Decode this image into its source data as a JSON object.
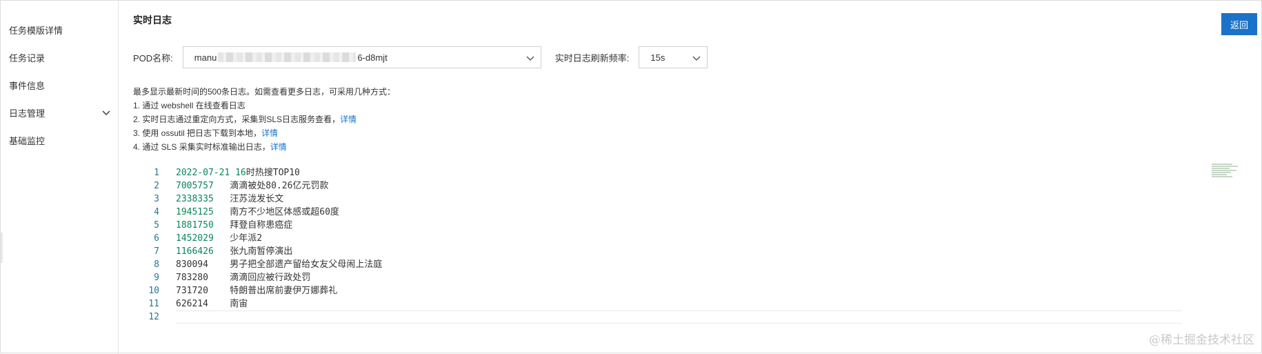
{
  "sidebar": {
    "items": [
      {
        "label": "任务模版详情"
      },
      {
        "label": "任务记录"
      },
      {
        "label": "事件信息"
      },
      {
        "label": "日志管理",
        "expandable": true
      },
      {
        "label": "基础监控"
      }
    ]
  },
  "header": {
    "title": "实时日志",
    "back_label": "返回"
  },
  "pod": {
    "label": "POD名称:",
    "value_prefix": "manu",
    "value_suffix": "6-d8mjt"
  },
  "refresh": {
    "label": "实时日志刷新频率:",
    "value": "15s"
  },
  "notice": {
    "line0": "最多显示最新时间的500条日志。如需查看更多日志，可采用几种方式：",
    "line1": "1. 通过 webshell 在线查看日志",
    "line2": "2. 实时日志通过重定向方式，采集到SLS日志服务查看，",
    "line2_link": "详情",
    "line3": "3. 使用 ossutil 把日志下载到本地，",
    "line3_link": "详情",
    "line4": "4. 通过 SLS 采集实时标准输出日志，",
    "line4_link": "详情"
  },
  "log": {
    "lines": [
      {
        "no": "1",
        "num": "2022-07-21 16",
        "text": "时热搜TOP10",
        "green": true
      },
      {
        "no": "2",
        "num": "7005757",
        "text": "   滴滴被处80.26亿元罚款",
        "green": true
      },
      {
        "no": "3",
        "num": "2338335",
        "text": "   汪苏泷发长文",
        "green": true
      },
      {
        "no": "4",
        "num": "1945125",
        "text": "   南方不少地区体感或超60度",
        "green": true
      },
      {
        "no": "5",
        "num": "1881750",
        "text": "   拜登自称患癌症",
        "green": true
      },
      {
        "no": "6",
        "num": "1452029",
        "text": "   少年派2",
        "green": true
      },
      {
        "no": "7",
        "num": "1166426",
        "text": "   张九南暂停演出",
        "green": true
      },
      {
        "no": "8",
        "num": "830094",
        "text": "    男子把全部遗产留给女友父母闹上法庭",
        "green": false
      },
      {
        "no": "9",
        "num": "783280",
        "text": "    滴滴回应被行政处罚",
        "green": false
      },
      {
        "no": "10",
        "num": "731720",
        "text": "    特朗普出席前妻伊万娜葬礼",
        "green": false
      },
      {
        "no": "11",
        "num": "626214",
        "text": "    南宙",
        "green": false
      },
      {
        "no": "12",
        "num": "",
        "text": "",
        "green": false
      }
    ]
  },
  "watermark": "@稀土掘金技术社区",
  "colors": {
    "primary": "#1a73c8",
    "line_number": "#237893",
    "number_green": "#098658"
  }
}
